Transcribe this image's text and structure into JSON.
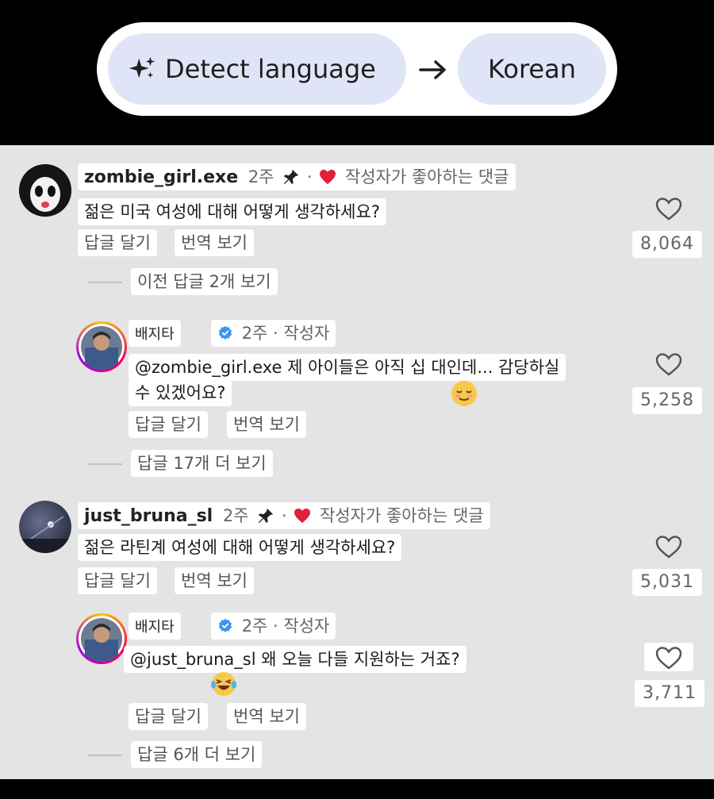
{
  "translate_bar": {
    "source_label": "Detect language",
    "target_label": "Korean"
  },
  "comments": [
    {
      "username": "zombie_girl.exe",
      "time": "2주",
      "dot": "·",
      "liked_by_author": "작성자가 좋아하는 댓글",
      "text": "젊은 미국 여성에 대해 어떻게 생각하세요?",
      "reply_label": "답글 달기",
      "translate_label": "번역 보기",
      "like_count": "8,064",
      "prev_replies_label": "이전 답글 2개 보기",
      "reply": {
        "username": "배지타",
        "meta": "2주 · 작성자",
        "text_line1": "@zombie_girl.exe 제 아이들은 아직 십 대인데... 감당하실",
        "text_line2": "수 있겠어요?",
        "reply_label": "답글 달기",
        "translate_label": "번역 보기",
        "like_count": "5,258",
        "more_replies_label": "답글 17개 더 보기"
      }
    },
    {
      "username": "just_bruna_sl",
      "time": "2주",
      "dot": "·",
      "liked_by_author": "작성자가 좋아하는 댓글",
      "text": "젊은 라틴계 여성에 대해 어떻게 생각하세요?",
      "reply_label": "답글 달기",
      "translate_label": "번역 보기",
      "like_count": "5,031",
      "reply": {
        "username": "배지타",
        "meta": "2주 · 작성자",
        "text_line1": "@just_bruna_sl 왜 오늘 다들 지원하는 거죠?",
        "reply_label": "답글 달기",
        "translate_label": "번역 보기",
        "like_count": "3,711",
        "more_replies_label": "답글 6개 더 보기"
      }
    }
  ],
  "colors": {
    "pill_bg": "#dfe5f7",
    "heart_red": "#e0203a",
    "verified_blue": "#3897f0",
    "comments_bg": "#e4e4e4"
  },
  "icons": [
    "sparkle-icon",
    "arrow-right-icon",
    "pin-icon",
    "red-heart-icon",
    "heart-outline-icon",
    "verified-badge-icon",
    "relieved-face-emoji",
    "laughing-tears-emoji"
  ]
}
